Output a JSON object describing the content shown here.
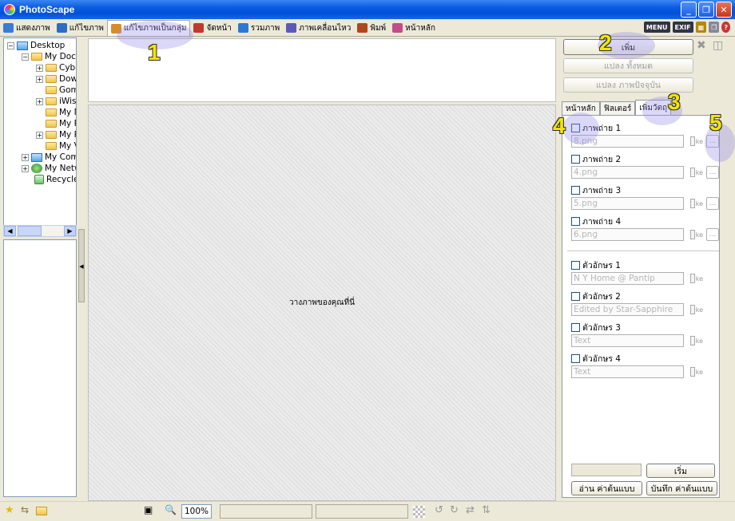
{
  "window": {
    "title": "PhotoScape",
    "min": "_",
    "max": "❐",
    "close": "✕"
  },
  "tabs": [
    {
      "label": "แสดงภาพ",
      "color": "#3a7bd5"
    },
    {
      "label": "แก้ไขภาพ",
      "color": "#2e6cc7"
    },
    {
      "label": "แก้ไขภาพเป็นกลุ่ม",
      "color": "#d98b2b"
    },
    {
      "label": "จัดหน้า",
      "color": "#c0392b"
    },
    {
      "label": "รวมภาพ",
      "color": "#2b79d4"
    },
    {
      "label": "ภาพเคลื่อนไหว",
      "color": "#5b5bb7"
    },
    {
      "label": "พิมพ์",
      "color": "#b0471b"
    },
    {
      "label": "หน้าหลัก",
      "color": "#c24d8a"
    }
  ],
  "toolbar_right": {
    "menu": "MENU",
    "exif": "EXIF"
  },
  "tree": [
    {
      "label": "Desktop",
      "level": 0,
      "icon": "desktop-icon",
      "exp": "−"
    },
    {
      "label": "My Documents",
      "level": 1,
      "icon": "folder-icon",
      "exp": "−"
    },
    {
      "label": "CyberLink",
      "level": 2,
      "icon": "folder-icon",
      "exp": "+"
    },
    {
      "label": "Downloads",
      "level": 2,
      "icon": "folder-icon",
      "exp": "+"
    },
    {
      "label": "Gom",
      "level": 2,
      "icon": "folder-icon",
      "exp": ""
    },
    {
      "label": "iWisoft",
      "level": 2,
      "icon": "folder-icon",
      "exp": "+"
    },
    {
      "label": "My Music",
      "level": 2,
      "icon": "folder-icon",
      "exp": ""
    },
    {
      "label": "My Pictures",
      "level": 2,
      "icon": "folder-icon",
      "exp": ""
    },
    {
      "label": "My Pictures",
      "level": 2,
      "icon": "folder-icon",
      "exp": "+"
    },
    {
      "label": "My Videos",
      "level": 2,
      "icon": "folder-icon",
      "exp": ""
    },
    {
      "label": "My Computer",
      "level": 1,
      "icon": "computer-icon",
      "exp": "+"
    },
    {
      "label": "My Network Places",
      "level": 1,
      "icon": "network-icon",
      "exp": "+"
    },
    {
      "label": "Recycle Bin",
      "level": 1,
      "icon": "recycle-bin-icon",
      "exp": ""
    }
  ],
  "center": {
    "drop_hint": "วางภาพของคุณที่นี่"
  },
  "right": {
    "add_button": "เพิ่ม",
    "convert_all": "แปลง ทั้งหมด",
    "convert_current": "แปลง ภาพปัจจุบัน",
    "subtabs": [
      "หน้าหลัก",
      "ฟิลเตอร์",
      "เพิ่มวัตถุ"
    ],
    "photos": [
      {
        "label": "ภาพถ่าย 1",
        "value": "8.png"
      },
      {
        "label": "ภาพถ่าย 2",
        "value": "4.png"
      },
      {
        "label": "ภาพถ่าย 3",
        "value": "5.png"
      },
      {
        "label": "ภาพถ่าย 4",
        "value": "6.png"
      }
    ],
    "texts": [
      {
        "label": "ตัวอักษร 1",
        "value": "N Y Home @ Pantip"
      },
      {
        "label": "ตัวอักษร 2",
        "value": "Edited by Star-Sapphire"
      },
      {
        "label": "ตัวอักษร 3",
        "value": "Text"
      },
      {
        "label": "ตัวอักษร 4",
        "value": "Text"
      }
    ],
    "edit_label": "ke",
    "dots": "...",
    "start_button": "เริ่ม",
    "load_preset": "อ่าน ค่าต้นแบบ",
    "save_preset": "บันทึก ค่าต้นแบบ"
  },
  "status": {
    "zoom": "100%"
  },
  "annotations": [
    "1",
    "2",
    "3",
    "4",
    "5"
  ]
}
